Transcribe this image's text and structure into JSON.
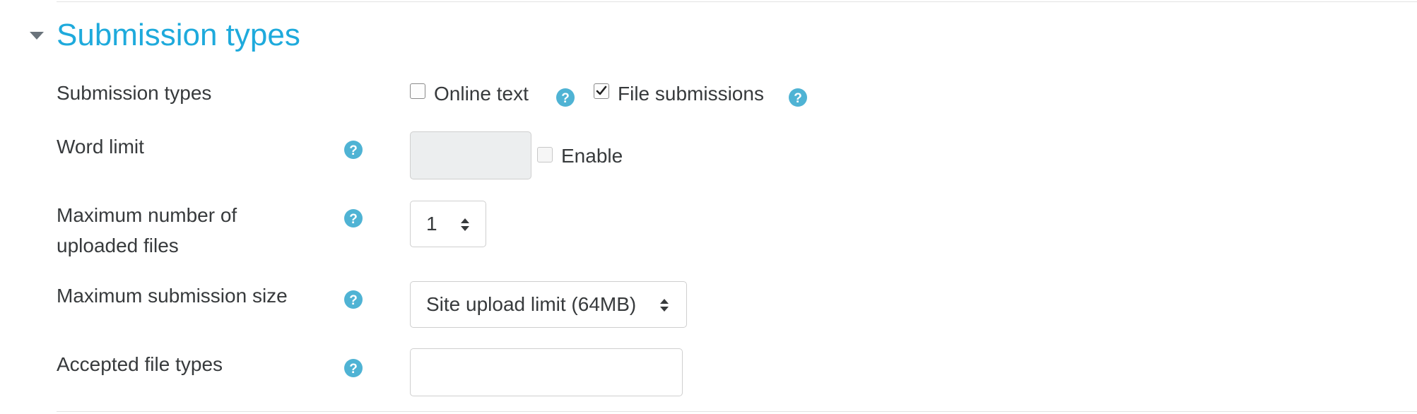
{
  "section": {
    "title": "Submission types"
  },
  "fields": {
    "submission_types": {
      "label": "Submission types",
      "online_text": {
        "label": "Online text",
        "checked": false
      },
      "file_submissions": {
        "label": "File submissions",
        "checked": true
      }
    },
    "word_limit": {
      "label": "Word limit",
      "value": "",
      "enable": {
        "label": "Enable",
        "checked": false
      }
    },
    "max_files": {
      "label_line1": "Maximum number of",
      "label_line2": "uploaded files",
      "selected": "1"
    },
    "max_size": {
      "label": "Maximum submission size",
      "selected": "Site upload limit (64MB)"
    },
    "file_types": {
      "label": "Accepted file types",
      "value": ""
    }
  },
  "colors": {
    "accent": "#1eaadc",
    "help_icon": "#4fb3d4",
    "text": "#373a3c",
    "border": "#cfcfcf",
    "disabled_bg": "#eceeef"
  },
  "icons": {
    "toggle": "caret-down-icon",
    "help": "question-circle-icon",
    "check": "checkmark-icon",
    "select": "sort-arrows-icon"
  }
}
